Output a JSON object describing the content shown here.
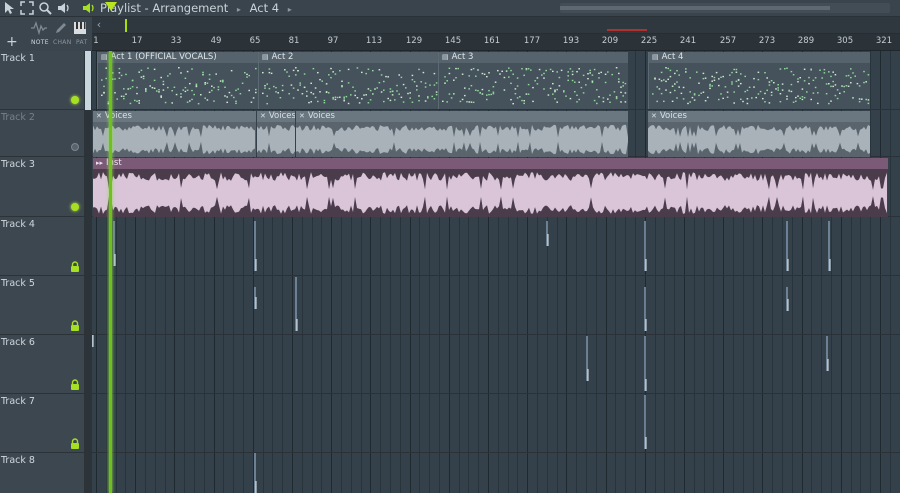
{
  "title": {
    "segments": [
      "Playlist",
      "Arrangement",
      "Act 4"
    ],
    "separator": "-",
    "crumb": "▸"
  },
  "toolbar": {
    "labels": [
      "NOTE",
      "CHAN",
      "PAT"
    ]
  },
  "ruler": {
    "ticks": [
      "1",
      "17",
      "33",
      "49",
      "65",
      "81",
      "97",
      "113",
      "129",
      "145",
      "161",
      "177",
      "193",
      "209",
      "225",
      "241",
      "257",
      "273",
      "289",
      "305",
      "321"
    ]
  },
  "tracks": [
    {
      "name": "Track 1",
      "indicator": "led-on"
    },
    {
      "name": "Track 2",
      "indicator": "led-off"
    },
    {
      "name": "Track 3",
      "indicator": "led-on"
    },
    {
      "name": "Track 4",
      "indicator": "lock"
    },
    {
      "name": "Track 5",
      "indicator": "lock"
    },
    {
      "name": "Track 6",
      "indicator": "lock"
    },
    {
      "name": "Track 7",
      "indicator": "lock"
    },
    {
      "name": "Track 8",
      "indicator": "none"
    }
  ],
  "clips": {
    "track1": [
      "Act 1 (OFFICIAL VOCALS)",
      "Act 2",
      "Act 3",
      "Act 4"
    ],
    "track2": [
      "Voices",
      "Voices",
      "Voices",
      "Voices"
    ],
    "track3": [
      "Inst"
    ]
  },
  "colors": {
    "accent": "#a6e022",
    "playhead": "#6fbf1f",
    "notes": "#8fd89a",
    "audio_wave": "#a9b2b9",
    "inst_wave": "#d9c4d8"
  },
  "icons": {
    "titlebar": [
      "cursor-icon",
      "fullscreen-icon",
      "zoom-icon",
      "speaker-icon",
      "playlist-speaker-icon"
    ],
    "pattern_clip": "pattern-icon",
    "audio_clip": "close-icon",
    "inst_clip": "audio-clip-icon",
    "lock": "lock-icon"
  }
}
